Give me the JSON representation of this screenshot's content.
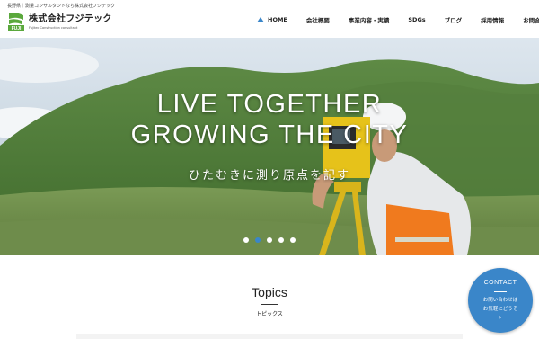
{
  "header": {
    "tagline": "長野県｜測量コンサルタントなら株式会社フジテック",
    "company_name": "株式会社フジテック",
    "company_name_en": "Fujitec Construction consultant",
    "logo_letters": "FUJI"
  },
  "nav": {
    "items": [
      {
        "label": "HOME",
        "icon": "triangle-icon"
      },
      {
        "label": "会社概要"
      },
      {
        "label": "事業内容・実績"
      },
      {
        "label": "SDGs"
      },
      {
        "label": "ブログ"
      },
      {
        "label": "採用情報"
      },
      {
        "label": "お問合せ"
      }
    ]
  },
  "hero": {
    "title_line1": "LIVE TOGETHER",
    "title_line2": "GROWING THE CITY",
    "subtitle": "ひたむきに測り原点を記す",
    "slide_count": 5,
    "active_slide": 2
  },
  "topics": {
    "title": "Topics",
    "subtitle": "トピックス"
  },
  "contact": {
    "title": "CONTACT",
    "line1": "お問い合わせは",
    "line2": "お気軽にどうぞ",
    "arrow": "›"
  },
  "colors": {
    "accent": "#3a86c9",
    "logo_green": "#5aa83c"
  }
}
